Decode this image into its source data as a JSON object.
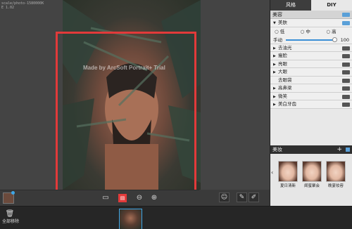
{
  "debug": {
    "line1": "scale/photo-1580000K",
    "line2": "E  1.02"
  },
  "canvas": {
    "watermark": "Made by ArcSoft Portrait+ Trial"
  },
  "toolbar": {
    "icons": [
      "fit-screen-icon",
      "compare-icon",
      "zoom-out-icon",
      "zoom-in-icon"
    ]
  },
  "mid_tools": [
    "face-detect-icon",
    "eraser-icon",
    "brush-icon"
  ],
  "filmstrip": {
    "remove_label": "全部移除"
  },
  "panel": {
    "tabs": [
      "风格",
      "DIY"
    ],
    "beauty_section": "美容",
    "smooth_row": "美肤",
    "radio_options": [
      "低",
      "中",
      "高"
    ],
    "manual_label": "手动",
    "manual_value": "100",
    "rows": [
      "去油光",
      "瘦脸",
      "亮眼",
      "大眼",
      "去眼袋",
      "高鼻梁",
      "微笑",
      "美白牙齿"
    ],
    "makeup_section": "美妆",
    "makeup_plus": "+",
    "makeup_items": [
      "夏日清新",
      "闺蜜聚会",
      "晚宴妆容"
    ]
  }
}
